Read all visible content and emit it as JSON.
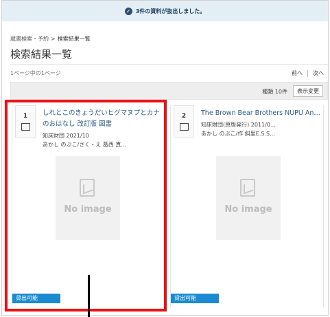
{
  "notice": {
    "icon": "check-circle-icon",
    "message": "3件の資料が抜出しました。"
  },
  "breadcrumb": {
    "items": [
      "蔵書検索・予約",
      "検索結果一覧"
    ],
    "separator": ">"
  },
  "page_title": "検索結果一覧",
  "page_info": "1ページ中の1ページ",
  "pager": {
    "prev": "前へ",
    "next": "次へ"
  },
  "toolbar": {
    "count": "種類 10件",
    "display_button": "表示変更"
  },
  "results": [
    {
      "number": "1",
      "icon": "book-icon",
      "title": "しれとこのきょうだいヒグマヌプとカナのおはなし 改訂版 図書",
      "publisher": "知床財団 2021/10",
      "author": "あかし のぶこ/さく・え 葛西 真…",
      "image_text": "No image",
      "status": "貸出可能"
    },
    {
      "number": "2",
      "icon": "book-icon",
      "title": "The Brown Bear Brothers NUPU An…",
      "publisher": "知床財団(原版発行) 2011/0…",
      "author": "あかし のぶこ/作 斜里E.S.S…",
      "image_text": "No image",
      "status": "貸出可能"
    }
  ],
  "colors": {
    "highlight": "#ee1111",
    "status_badge": "#1a8bd1",
    "notice_bg": "#e3eff5"
  }
}
